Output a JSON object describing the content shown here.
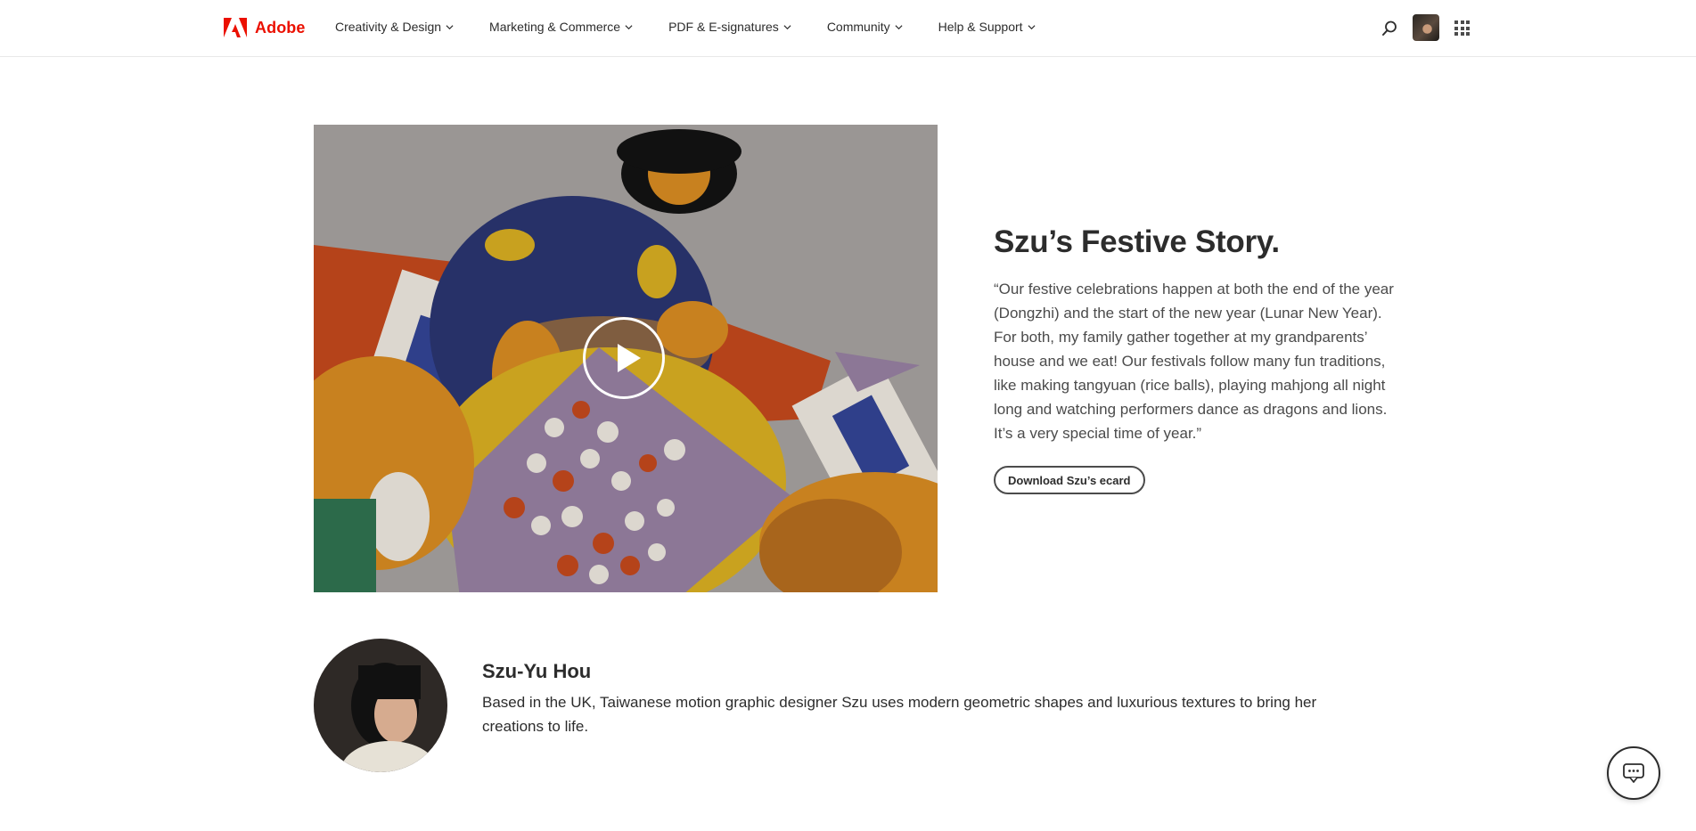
{
  "header": {
    "brand": "Adobe",
    "nav": [
      {
        "label": "Creativity & Design",
        "icon": "chevron-down-icon"
      },
      {
        "label": "Marketing & Commerce",
        "icon": "chevron-down-icon"
      },
      {
        "label": "PDF & E-signatures",
        "icon": "chevron-down-icon"
      },
      {
        "label": "Community",
        "icon": "chevron-down-icon"
      },
      {
        "label": "Help & Support",
        "icon": "chevron-down-icon"
      }
    ],
    "icons": {
      "search": "search-icon",
      "apps": "app-grid-icon"
    }
  },
  "story": {
    "title": "Szu’s Festive Story.",
    "quote": "“Our festive celebrations happen at both the end of the year (Dongzhi) and the start of the new year (Lunar New Year). For both, my family gather together at my grandparents’ house and we eat! Our festivals follow many fun traditions, like making tangyuan (rice balls), playing mahjong all night long and watching performers dance as dragons and lions. It’s a very special time of year.”",
    "cta_label": "Download Szu’s ecard",
    "video_icon": "play-icon"
  },
  "artist": {
    "name": "Szu-Yu Hou",
    "bio": "Based in the UK, Taiwanese motion graphic designer Szu uses modern geometric shapes and luxurious textures to bring her creations to life."
  },
  "chat": {
    "icon": "chat-icon"
  },
  "colors": {
    "brand_red": "#eb1000",
    "text": "#2c2c2c",
    "illustration_bg": "#9a9694",
    "illustration_navy": "#273168",
    "illustration_ochre": "#c8811f",
    "illustration_purple": "#8c7796",
    "illustration_rust": "#b5431a"
  }
}
